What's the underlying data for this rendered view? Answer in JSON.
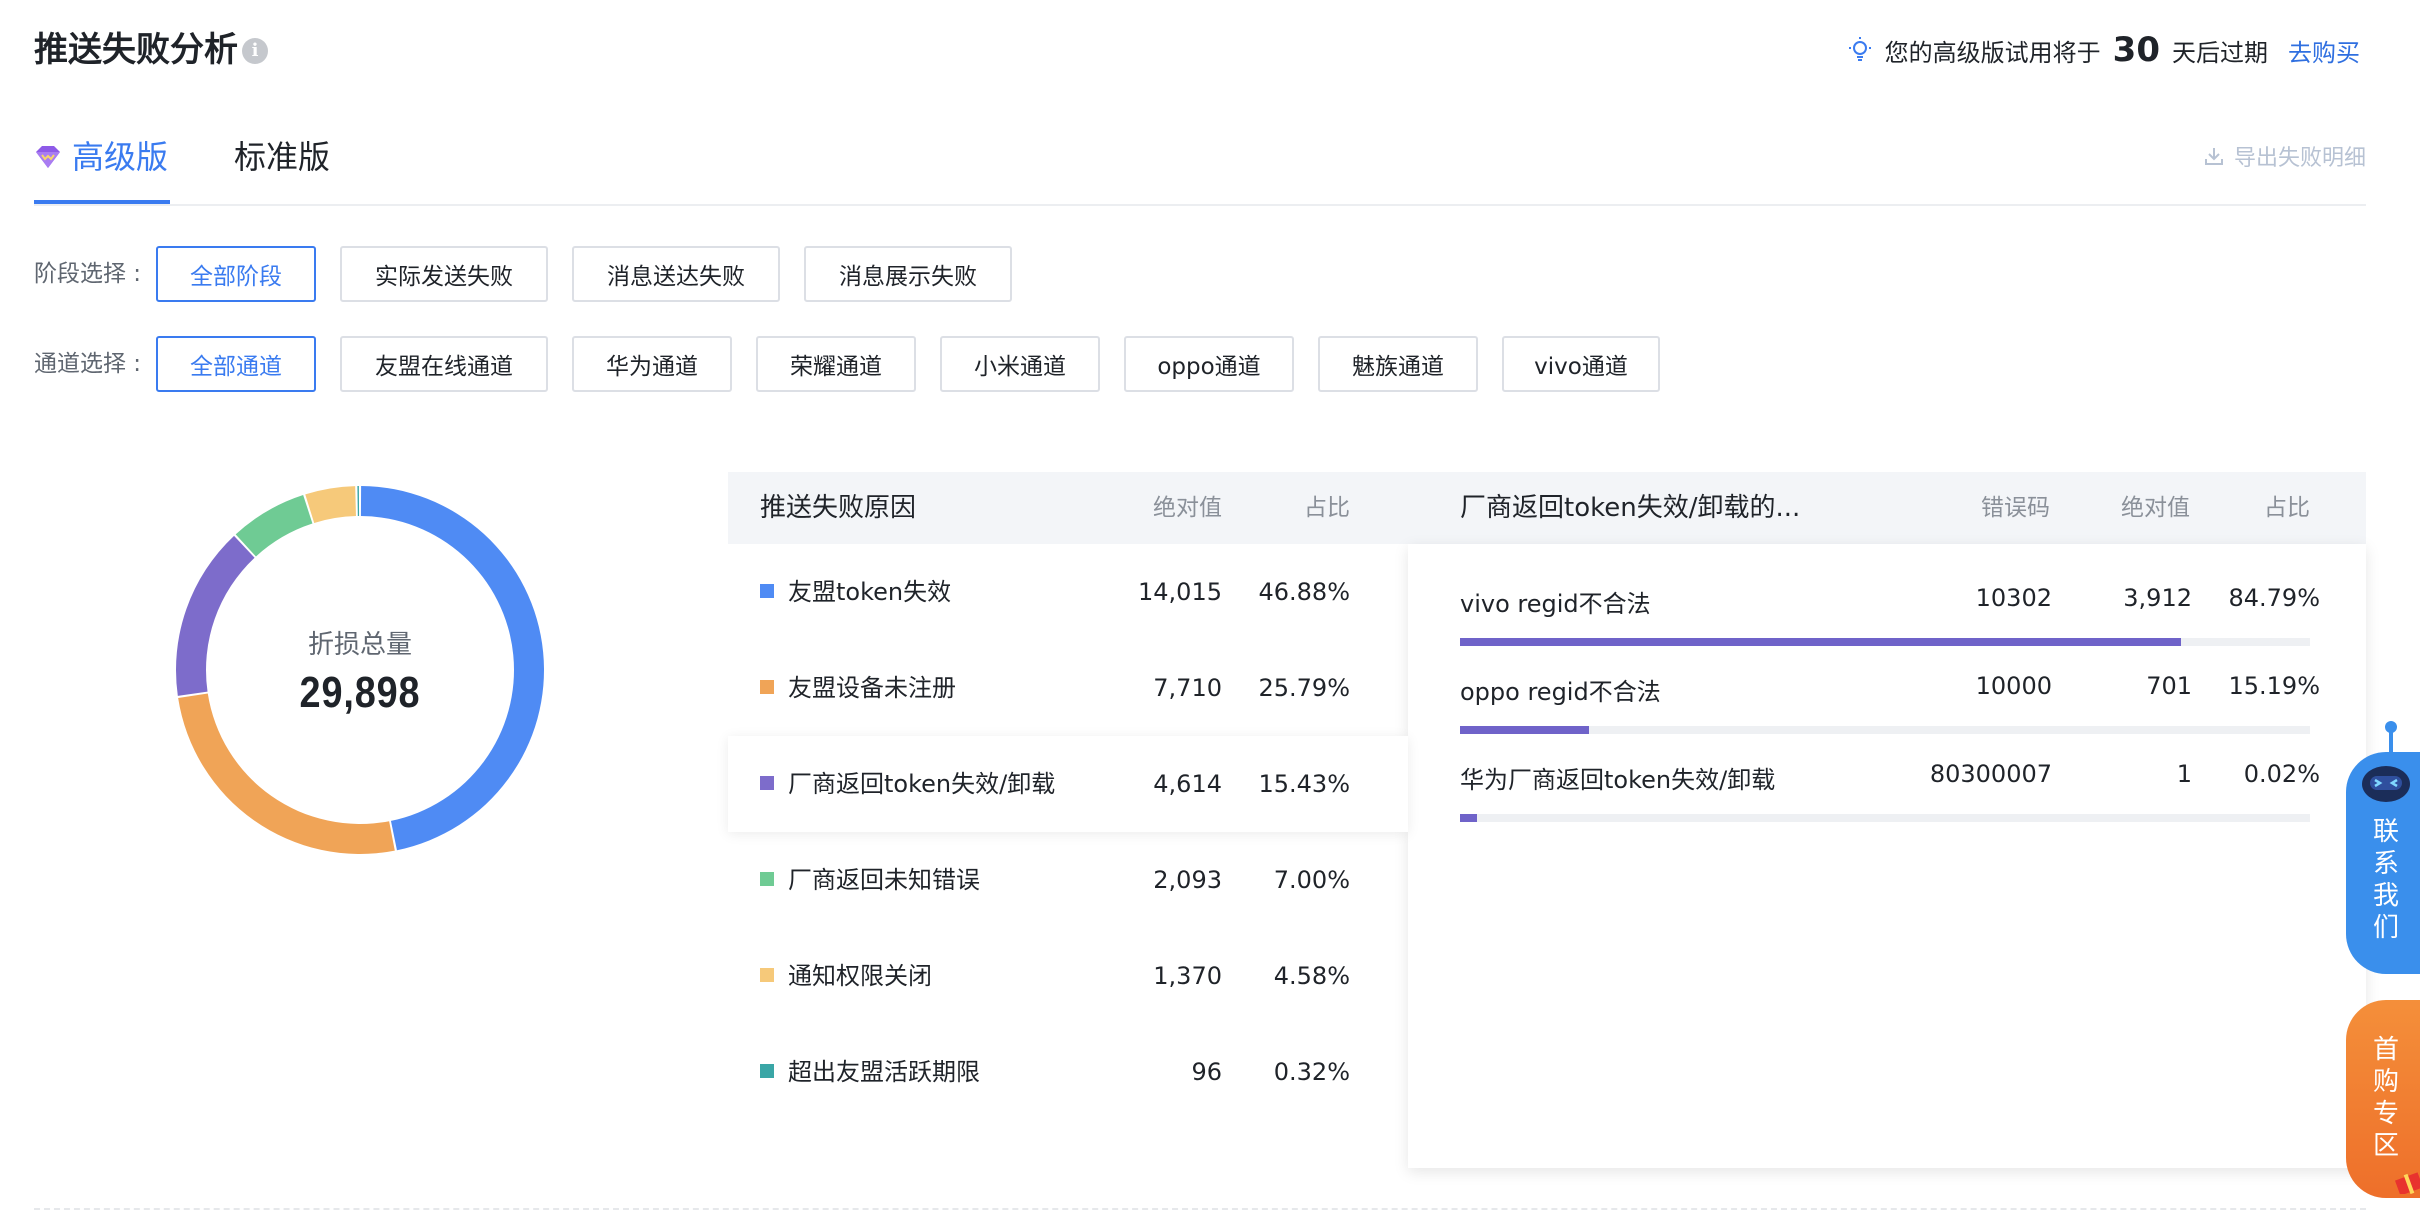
{
  "header": {
    "title": "推送失败分析",
    "trial_prefix": "您的高级版试用将于",
    "trial_days": "30",
    "trial_suffix": "天后过期",
    "buy_link": "去购买"
  },
  "tabs": [
    {
      "label": "高级版",
      "active": true
    },
    {
      "label": "标准版",
      "active": false
    }
  ],
  "export_label": "导出失败明细",
  "stage_filter": {
    "label": "阶段选择 :",
    "options": [
      "全部阶段",
      "实际发送失败",
      "消息送达失败",
      "消息展示失败"
    ],
    "selected": "全部阶段"
  },
  "channel_filter": {
    "label": "通道选择 :",
    "options": [
      "全部通道",
      "友盟在线通道",
      "华为通道",
      "荣耀通道",
      "小米通道",
      "oppo通道",
      "魅族通道",
      "vivo通道"
    ],
    "selected": "全部通道"
  },
  "donut": {
    "label": "折损总量",
    "total": "29,898"
  },
  "chart_data": {
    "type": "pie",
    "categories": [
      "友盟token失效",
      "友盟设备未注册",
      "厂商返回token失效/卸载",
      "厂商返回未知错误",
      "通知权限关闭",
      "超出友盟活跃期限"
    ],
    "values": [
      14015,
      7710,
      4614,
      2093,
      1370,
      96
    ],
    "colors": [
      "#4f8bf4",
      "#f0a457",
      "#7d6ccb",
      "#6fcb94",
      "#f6c97a",
      "#3aa6a6"
    ]
  },
  "reasons_table": {
    "headers": {
      "reason": "推送失败原因",
      "abs": "绝对值",
      "pct": "占比"
    },
    "rows": [
      {
        "name": "友盟token失效",
        "abs": "14,015",
        "pct": "46.88%",
        "color": "#4f8bf4"
      },
      {
        "name": "友盟设备未注册",
        "abs": "7,710",
        "pct": "25.79%",
        "color": "#f0a457"
      },
      {
        "name": "厂商返回token失效/卸载",
        "abs": "4,614",
        "pct": "15.43%",
        "color": "#7d6ccb"
      },
      {
        "name": "厂商返回未知错误",
        "abs": "2,093",
        "pct": "7.00%",
        "color": "#6fcb94"
      },
      {
        "name": "通知权限关闭",
        "abs": "1,370",
        "pct": "4.58%",
        "color": "#f6c97a"
      },
      {
        "name": "超出友盟活跃期限",
        "abs": "96",
        "pct": "0.32%",
        "color": "#3aa6a6"
      }
    ],
    "selected_index": 2
  },
  "detail_table": {
    "headers": {
      "title": "厂商返回token失效/卸载的...",
      "code": "错误码",
      "abs": "绝对值",
      "pct": "占比"
    },
    "rows": [
      {
        "name": "vivo regid不合法",
        "code": "10302",
        "abs": "3,912",
        "pct": "84.79%",
        "ratio": 0.8479
      },
      {
        "name": "oppo regid不合法",
        "code": "10000",
        "abs": "701",
        "pct": "15.19%",
        "ratio": 0.1519
      },
      {
        "name": "华为厂商返回token失效/卸载",
        "code": "80300007",
        "abs": "1",
        "pct": "0.02%",
        "ratio": 0.0002
      }
    ],
    "bar_color": "#6f63c9"
  },
  "widgets": {
    "contact": "联系我们",
    "promo": "首购专区"
  }
}
